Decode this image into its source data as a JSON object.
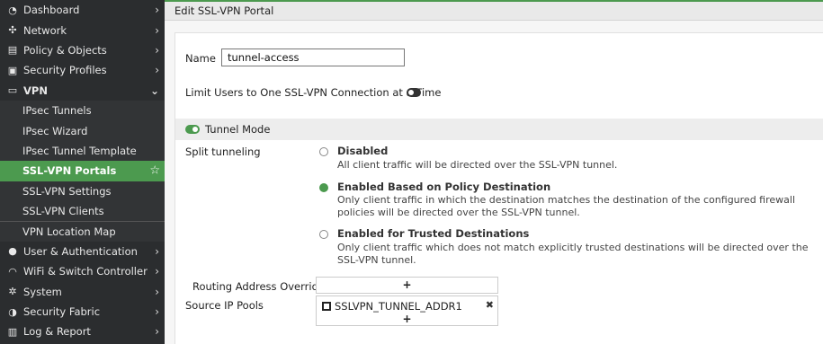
{
  "sidebar": {
    "items": [
      {
        "label": "Dashboard",
        "icon": "dashboard-icon",
        "glyph": "◔",
        "chevron": "›"
      },
      {
        "label": "Network",
        "icon": "network-icon",
        "glyph": "✣",
        "chevron": "›"
      },
      {
        "label": "Policy & Objects",
        "icon": "policy-icon",
        "glyph": "▤",
        "chevron": "›"
      },
      {
        "label": "Security Profiles",
        "icon": "lock-icon",
        "glyph": "▣",
        "chevron": "›"
      },
      {
        "label": "VPN",
        "icon": "monitor-icon",
        "glyph": "▭",
        "chevron": "⌄"
      }
    ],
    "vpn_sub": [
      "IPsec Tunnels",
      "IPsec Wizard",
      "IPsec Tunnel Template",
      "SSL-VPN Portals",
      "SSL-VPN Settings",
      "SSL-VPN Clients",
      "VPN Location Map"
    ],
    "items_after": [
      {
        "label": "User & Authentication",
        "icon": "user-icon",
        "glyph": "●",
        "chevron": "›"
      },
      {
        "label": "WiFi & Switch Controller",
        "icon": "wifi-icon",
        "glyph": "◠",
        "chevron": "›"
      },
      {
        "label": "System",
        "icon": "gear-icon",
        "glyph": "✲",
        "chevron": "›"
      },
      {
        "label": "Security Fabric",
        "icon": "fabric-icon",
        "glyph": "◑",
        "chevron": "›"
      },
      {
        "label": "Log & Report",
        "icon": "chart-icon",
        "glyph": "▥",
        "chevron": "›"
      }
    ],
    "active_star": "☆"
  },
  "page": {
    "title": "Edit SSL-VPN Portal",
    "name_label": "Name",
    "name_value": "tunnel-access",
    "limit_label": "Limit Users to One SSL-VPN Connection at a Time",
    "limit_enabled": false,
    "tunnel_mode_label": "Tunnel Mode",
    "tunnel_mode_enabled": true,
    "split_label": "Split tunneling",
    "options": [
      {
        "title": "Disabled",
        "desc": "All client traffic will be directed over the SSL-VPN tunnel.",
        "checked": false
      },
      {
        "title": "Enabled Based on Policy Destination",
        "desc": "Only client traffic in which the destination matches the destination of the configured firewall policies will be directed over the SSL-VPN tunnel.",
        "checked": true
      },
      {
        "title": "Enabled for Trusted Destinations",
        "desc": "Only client traffic which does not match explicitly trusted destinations will be directed over the SSL-VPN tunnel.",
        "checked": false
      }
    ],
    "routing_label": "Routing Address Override",
    "source_pools_label": "Source IP Pools",
    "source_pool_entry": "SSLVPN_TUNNEL_ADDR1",
    "plus": "+",
    "remove": "✖"
  },
  "colors": {
    "accent": "#4c9a4f",
    "sidebar_bg": "#2b2d2f"
  }
}
